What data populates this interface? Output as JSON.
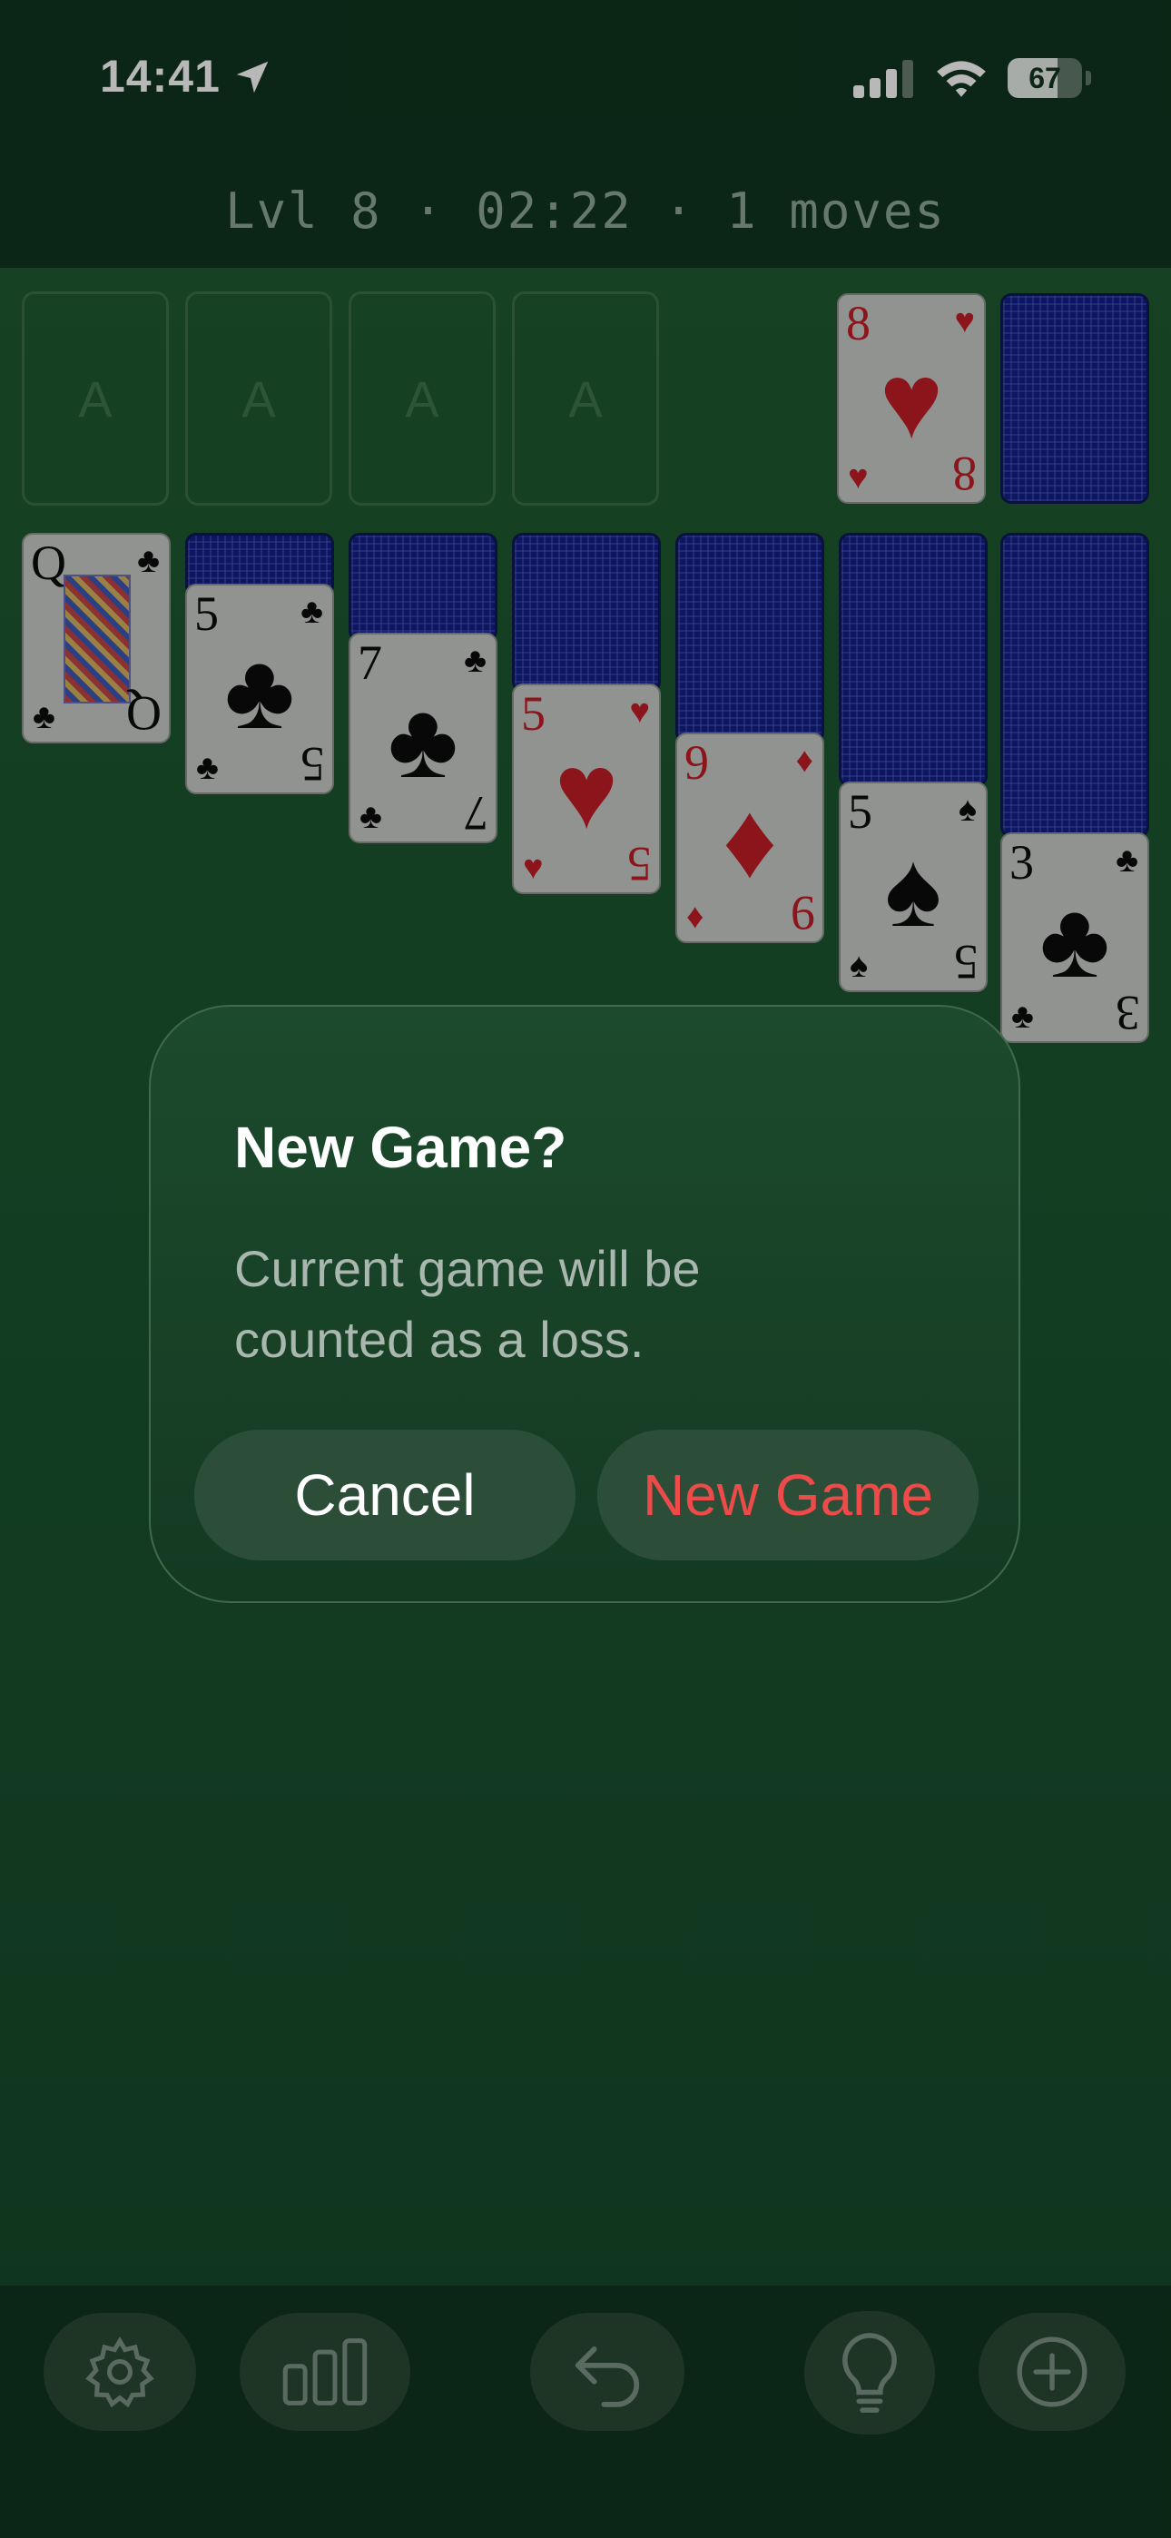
{
  "status_bar": {
    "time": "14:41",
    "battery_percent": 67,
    "battery_label": "67",
    "icons": [
      "location-arrow-icon",
      "cellular-signal-icon",
      "wifi-icon",
      "battery-icon"
    ]
  },
  "hud": {
    "text": "Lvl 8 · 02:22 · 1 moves"
  },
  "foundations": [
    "A",
    "A",
    "A",
    "A"
  ],
  "waste_card": {
    "rank": "8",
    "suit": "♥",
    "color": "red"
  },
  "tableau": [
    {
      "rank": "Q",
      "suit": "♣",
      "color": "black",
      "hidden": 0,
      "face_card": true
    },
    {
      "rank": "5",
      "suit": "♣",
      "color": "black",
      "hidden": 1
    },
    {
      "rank": "7",
      "suit": "♣",
      "color": "black",
      "hidden": 2
    },
    {
      "rank": "5",
      "suit": "♥",
      "color": "red",
      "hidden": 3
    },
    {
      "rank": "9",
      "suit": "♦",
      "color": "red",
      "hidden": 4
    },
    {
      "rank": "5",
      "suit": "♠",
      "color": "black",
      "hidden": 5
    },
    {
      "rank": "3",
      "suit": "♣",
      "color": "black",
      "hidden": 6
    }
  ],
  "dialog": {
    "title": "New Game?",
    "message": "Current game will be counted as a loss.",
    "cancel_label": "Cancel",
    "confirm_label": "New Game"
  },
  "toolbar": [
    "settings-gear-icon",
    "stats-bars-icon",
    "undo-arrow-icon",
    "hint-lightbulb-icon",
    "new-game-plus-icon"
  ],
  "colors": {
    "felt": "#1f5a30",
    "bar": "#10351f",
    "card_back": "#141f86",
    "destructive": "#ef4a4a"
  }
}
